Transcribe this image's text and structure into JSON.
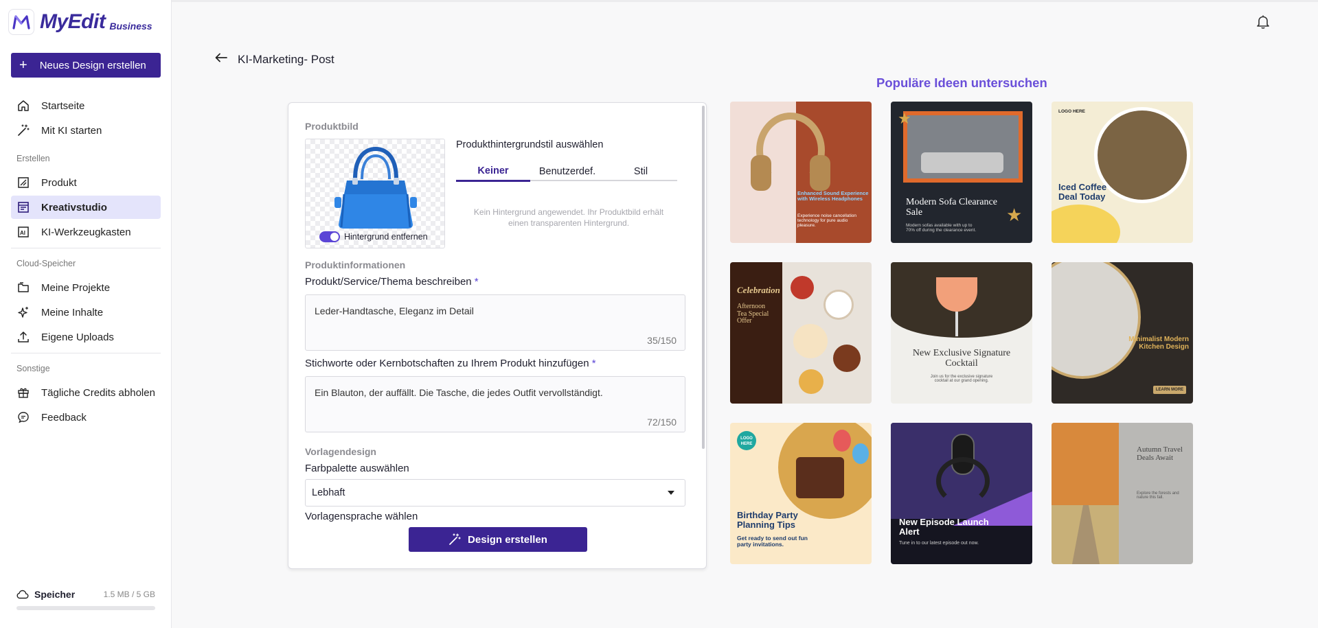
{
  "brand": {
    "name": "MyEdit",
    "tier": "Business"
  },
  "sidebar": {
    "new_design": "Neues Design erstellen",
    "home": "Startseite",
    "ai_start": "Mit KI starten",
    "create_section": "Erstellen",
    "product": "Produkt",
    "creative_studio": "Kreativstudio",
    "ai_toolbox": "KI-Werkzeugkasten",
    "cloud_section": "Cloud-Speicher",
    "my_projects": "Meine Projekte",
    "my_content": "Meine Inhalte",
    "own_uploads": "Eigene Uploads",
    "other_section": "Sonstige",
    "daily_credits": "Tägliche Credits abholen",
    "feedback": "Feedback",
    "storage_label": "Speicher",
    "storage_amount": "1.5 MB / 5 GB",
    "storage_used_fraction": 0.0003
  },
  "page": {
    "title": "KI-Marketing- Post"
  },
  "form": {
    "product_image_title": "Produktbild",
    "remove_bg_label": "Hintergrund entfernen",
    "bg_style_label": "Produkthintergrundstil auswählen",
    "tabs": [
      "Keiner",
      "Benutzerdef.",
      "Stil"
    ],
    "bg_note": "Kein Hintergrund angewendet. Ihr Produktbild erhält einen transparenten Hintergrund.",
    "product_info_title": "Produktinformationen",
    "describe_label": "Produkt/Service/Thema beschreiben",
    "describe_value": "Leder-Handtasche, Eleganz im Detail",
    "describe_count": "35/150",
    "keywords_label": "Stichworte oder Kernbotschaften zu Ihrem Produkt hinzufügen",
    "keywords_value": "Ein Blauton, der auffällt. Die Tasche, die jedes Outfit vervollständigt.",
    "keywords_count": "72/150",
    "required_mark": "*",
    "template_design_title": "Vorlagendesign",
    "palette_label": "Farbpalette auswählen",
    "palette_value": "Lebhaft",
    "language_label": "Vorlagensprache wählen",
    "create_button": "Design erstellen"
  },
  "ideas": {
    "title": "Populäre Ideen untersuchen",
    "tiles": [
      {
        "text": "Enhanced Sound Experience with Wireless Headphones",
        "sub": "Experience noise cancellation technology for pure audio pleasure."
      },
      {
        "text": "Modern Sofa Clearance Sale",
        "sub": "Modern sofas available with up to 70% off during the clearance event."
      },
      {
        "text": "Iced Coffee Deal Today",
        "sub": "LOGO HERE"
      },
      {
        "text": "Celebration",
        "sub": "Afternoon Tea Special Offer"
      },
      {
        "text": "New Exclusive Signature Cocktail",
        "sub": "Join us for the exclusive signature cocktail at our grand opening."
      },
      {
        "text": "Minimalist Modern Kitchen Design",
        "sub": "LEARN MORE"
      },
      {
        "text": "Birthday Party Planning Tips",
        "sub": "Get ready to send out fun party invitations."
      },
      {
        "text": "New Episode Launch Alert",
        "sub": "Tune in to our latest episode out now."
      },
      {
        "text": "Autumn Travel Deals Await",
        "sub": "Explore the forests and nature this fall."
      }
    ]
  }
}
